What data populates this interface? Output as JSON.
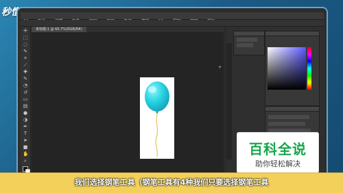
{
  "branding": {
    "logo_text": "秒懂视频",
    "badge_title": "百科全说",
    "badge_subtitle": "助你轻松解决"
  },
  "subtitle": "我们选择钢笔工具（钢笔工具有4种我们只要选择钢笔工具",
  "app": {
    "menu_items": [
      "PS",
      "文件",
      "编辑",
      "图像",
      "图层",
      "文字",
      "选择",
      "滤镜",
      "3D",
      "视图",
      "窗口",
      "帮助"
    ],
    "document_tab": "未标题-1 @ 66.7%(RGB/8#)"
  },
  "colors": {
    "balloon_top": "#8ff4ff",
    "balloon_mid": "#27d4e0",
    "balloon_bottom": "#19a6c2",
    "string": "#e8c25a",
    "subtitle_bar": "#f2d05a",
    "brand_green": "#16a64a"
  },
  "icons": {
    "tools": [
      "move-tool-icon",
      "marquee-tool-icon",
      "lasso-tool-icon",
      "quick-select-tool-icon",
      "crop-tool-icon",
      "eyedropper-tool-icon",
      "heal-tool-icon",
      "brush-tool-icon",
      "clone-tool-icon",
      "history-brush-tool-icon",
      "eraser-tool-icon",
      "gradient-tool-icon",
      "blur-tool-icon",
      "dodge-tool-icon",
      "pen-tool-icon",
      "type-tool-icon",
      "path-select-tool-icon",
      "shape-tool-icon",
      "hand-tool-icon",
      "zoom-tool-icon"
    ]
  }
}
